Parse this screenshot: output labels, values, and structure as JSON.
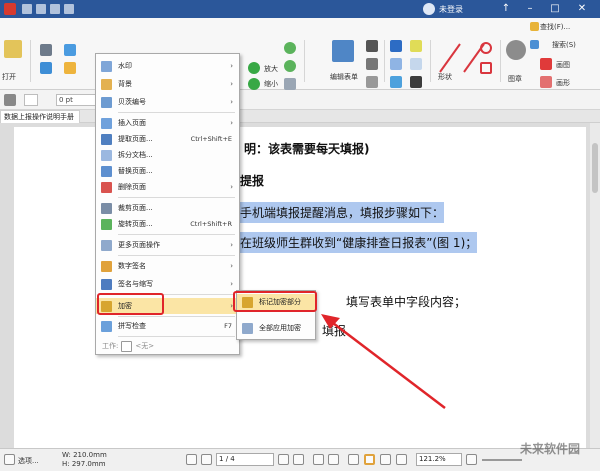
{
  "titlebar": {
    "login_label": "未登录",
    "window_controls": [
      "pin-icon",
      "minimize-icon",
      "maximize-icon",
      "close-icon"
    ]
  },
  "ribbon": {
    "search_label": "查找(F)...",
    "search2_label": "搜索(S)",
    "open_label": "打开",
    "enlarge_label": "放大",
    "reduce_label": "缩小",
    "edit_form_label": "编辑表单",
    "shape_label": "形状",
    "stamp_label": "图章",
    "draw_label": "画图",
    "draw2_label": "画形"
  },
  "format_bar": {
    "size_value": "0 pt"
  },
  "tab": {
    "label": "数据上报操作说明手册"
  },
  "document": {
    "line1": "明：该表需要每天填报)",
    "line2": "提报",
    "line3": "手机端填报提醒消息，填报步骤如下：",
    "line4": "在班级师生群收到“健康排查日报表”(图 1)；",
    "line5": "填写表单中字段内容；",
    "line6": "填报"
  },
  "context_menu": {
    "items": [
      {
        "label": "水印",
        "arrow": "›"
      },
      {
        "label": "背景",
        "arrow": "›"
      },
      {
        "label": "贝茨编号",
        "arrow": "›"
      },
      {
        "label": "插入页面",
        "arrow": "›"
      },
      {
        "label": "提取页面...",
        "shortcut": "Ctrl+Shift+E"
      },
      {
        "label": "拆分文档..."
      },
      {
        "label": "替换页面..."
      },
      {
        "label": "删除页面",
        "arrow": "›"
      },
      {
        "label": "裁剪页面..."
      },
      {
        "label": "旋转页面...",
        "shortcut": "Ctrl+Shift+R"
      },
      {
        "label": "更多页面操作",
        "arrow": "›"
      },
      {
        "label": "数字签名",
        "arrow": "›"
      },
      {
        "label": "签名与缩写",
        "arrow": "›"
      },
      {
        "label": "加密",
        "arrow": "›"
      },
      {
        "label": "拼写检查",
        "shortcut": "F7"
      }
    ],
    "footer_label": "工作: ",
    "footer_value": "<无>"
  },
  "submenu": {
    "items": [
      {
        "label": "标记加密部分"
      },
      {
        "label": "全部应用加密"
      }
    ]
  },
  "statusbar": {
    "fit_label": "选项...",
    "width_label": "W: 210.0mm",
    "height_label": "H: 297.0mm",
    "page_current": "1",
    "page_total": "/ 4",
    "zoom": "121.2%",
    "watermark": "未来软件园"
  }
}
